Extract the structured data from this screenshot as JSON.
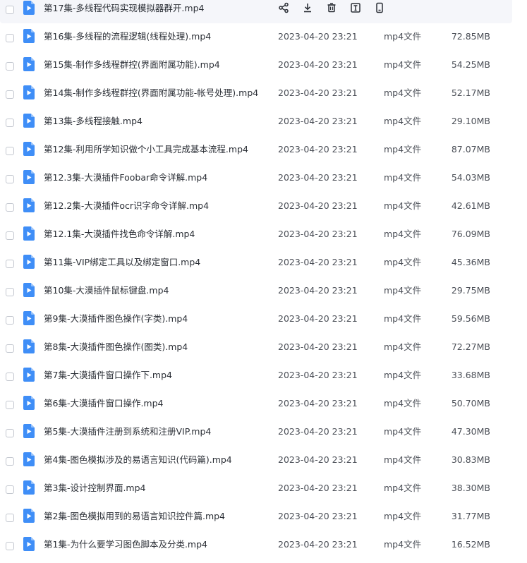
{
  "colors": {
    "file_icon": "#3f8ef7",
    "hover_row": "#f5f6fa",
    "action_icon": "#2b2f36"
  },
  "hovered_row": {
    "name": "第17集-多线程代码实现模拟器群开.mp4",
    "actions": [
      "share-icon",
      "download-icon",
      "delete-icon",
      "text-extract-icon",
      "phone-icon"
    ]
  },
  "files": [
    {
      "name": "第16集-多线程的流程逻辑(线程处理).mp4",
      "date": "2023-04-20 23:21",
      "type": "mp4文件",
      "size": "72.85MB"
    },
    {
      "name": "第15集-制作多线程群控(界面附属功能).mp4",
      "date": "2023-04-20 23:21",
      "type": "mp4文件",
      "size": "54.25MB"
    },
    {
      "name": "第14集-制作多线程群控(界面附属功能-帐号处理).mp4",
      "date": "2023-04-20 23:21",
      "type": "mp4文件",
      "size": "52.17MB"
    },
    {
      "name": "第13集-多线程接触.mp4",
      "date": "2023-04-20 23:21",
      "type": "mp4文件",
      "size": "29.10MB"
    },
    {
      "name": "第12集-利用所学知识做个小工具完成基本流程.mp4",
      "date": "2023-04-20 23:21",
      "type": "mp4文件",
      "size": "87.07MB"
    },
    {
      "name": "第12.3集-大漠插件Foobar命令详解.mp4",
      "date": "2023-04-20 23:21",
      "type": "mp4文件",
      "size": "54.03MB"
    },
    {
      "name": "第12.2集-大漠插件ocr识字命令详解.mp4",
      "date": "2023-04-20 23:21",
      "type": "mp4文件",
      "size": "42.61MB"
    },
    {
      "name": "第12.1集-大漠插件找色命令详解.mp4",
      "date": "2023-04-20 23:21",
      "type": "mp4文件",
      "size": "76.09MB"
    },
    {
      "name": "第11集-VIP绑定工具以及绑定窗口.mp4",
      "date": "2023-04-20 23:21",
      "type": "mp4文件",
      "size": "45.36MB"
    },
    {
      "name": "第10集-大漠插件鼠标键盘.mp4",
      "date": "2023-04-20 23:21",
      "type": "mp4文件",
      "size": "29.75MB"
    },
    {
      "name": "第9集-大漠插件图色操作(字类).mp4",
      "date": "2023-04-20 23:21",
      "type": "mp4文件",
      "size": "59.56MB"
    },
    {
      "name": "第8集-大漠插件图色操作(图类).mp4",
      "date": "2023-04-20 23:21",
      "type": "mp4文件",
      "size": "72.27MB"
    },
    {
      "name": "第7集-大漠插件窗口操作下.mp4",
      "date": "2023-04-20 23:21",
      "type": "mp4文件",
      "size": "33.68MB"
    },
    {
      "name": "第6集-大漠插件窗口操作.mp4",
      "date": "2023-04-20 23:21",
      "type": "mp4文件",
      "size": "50.70MB"
    },
    {
      "name": "第5集-大漠插件注册到系统和注册VIP.mp4",
      "date": "2023-04-20 23:21",
      "type": "mp4文件",
      "size": "47.30MB"
    },
    {
      "name": "第4集-图色模拟涉及的易语言知识(代码篇).mp4",
      "date": "2023-04-20 23:21",
      "type": "mp4文件",
      "size": "30.83MB"
    },
    {
      "name": "第3集-设计控制界面.mp4",
      "date": "2023-04-20 23:21",
      "type": "mp4文件",
      "size": "38.30MB"
    },
    {
      "name": "第2集-图色模拟用到的易语言知识控件篇.mp4",
      "date": "2023-04-20 23:21",
      "type": "mp4文件",
      "size": "31.77MB"
    },
    {
      "name": "第1集-为什么要学习图色脚本及分类.mp4",
      "date": "2023-04-20 23:21",
      "type": "mp4文件",
      "size": "16.52MB"
    }
  ]
}
